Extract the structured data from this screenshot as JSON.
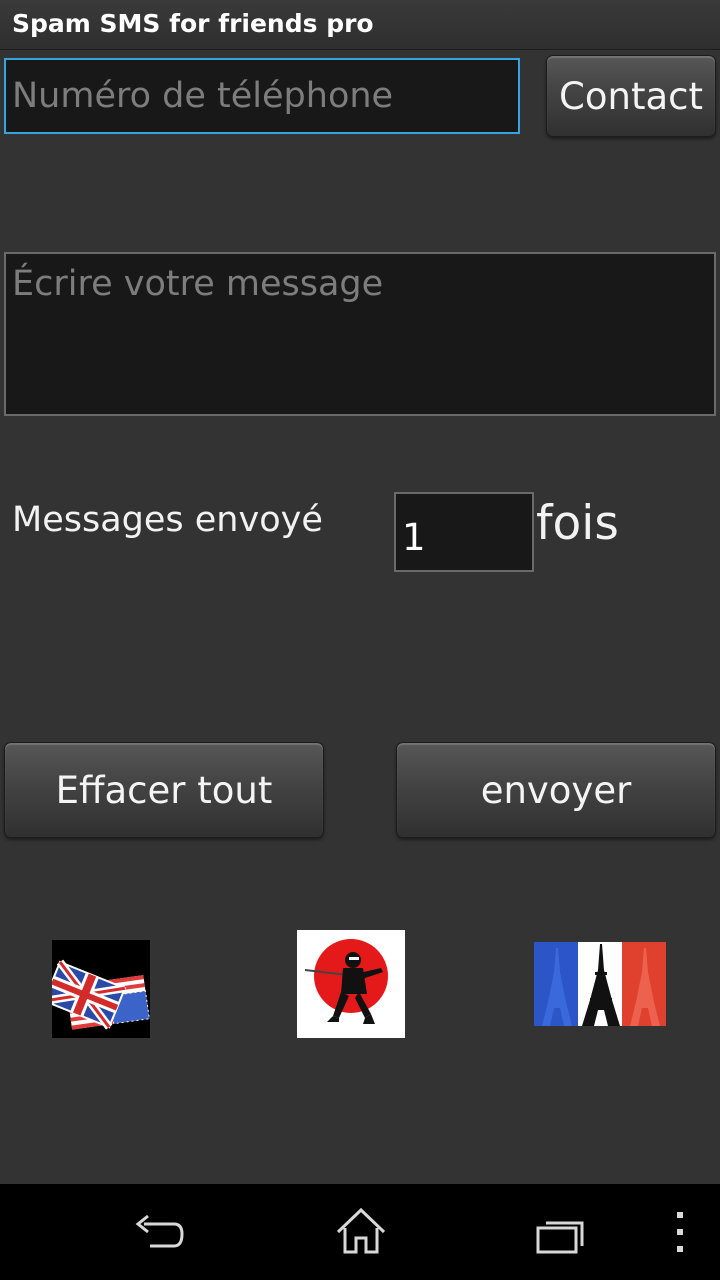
{
  "app": {
    "title": "Spam SMS for friends pro"
  },
  "phone": {
    "placeholder": "Numéro de téléphone",
    "value": ""
  },
  "contact_button": {
    "label": "Contact"
  },
  "message": {
    "placeholder": "Écrire votre message",
    "value": ""
  },
  "repeat": {
    "label": "Messages envoyé",
    "count": "1",
    "suffix": "fois"
  },
  "actions": {
    "clear_label": "Effacer tout",
    "send_label": "envoyer"
  },
  "languages": [
    {
      "icon": "uk-us-flags-icon"
    },
    {
      "icon": "japanese-ninja-icon"
    },
    {
      "icon": "french-flag-eiffel-icon"
    }
  ],
  "navbar": {
    "icons": [
      "back-icon",
      "home-icon",
      "recent-apps-icon",
      "overflow-menu-icon"
    ]
  },
  "colors": {
    "focus_border": "#33a6e0",
    "background": "#333333",
    "field_bg": "#181818"
  }
}
